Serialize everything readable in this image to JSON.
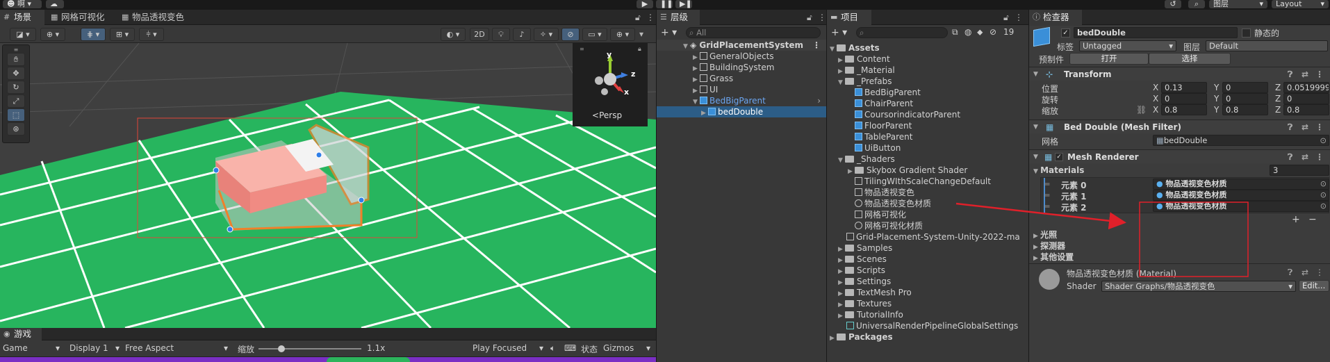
{
  "topbar": {
    "account_label": "啊",
    "layers_label": "图层",
    "layout_label": "Layout"
  },
  "scene_tabs": [
    {
      "label": "场景"
    },
    {
      "label": "网格可视化"
    },
    {
      "label": "物品透视变色"
    }
  ],
  "scene_toolbar": {
    "btn_2d": "2D"
  },
  "gizmo": {
    "y": "y",
    "z": "z",
    "x": "x",
    "persp": "Persp"
  },
  "game_bar": {
    "tab_label": "游戏",
    "game_select": "Game",
    "display_select": "Display 1",
    "aspect_select": "Free Aspect",
    "scale_label": "缩放",
    "scale_value": "1.1x",
    "play_focused": "Play Focused",
    "stats_label": "状态",
    "gizmos_label": "Gizmos",
    "scale_fraction": 0.22
  },
  "hierarchy": {
    "tab_label": "层级",
    "search_placeholder": "All",
    "scene_name": "GridPlacementSystem",
    "items": [
      {
        "label": "GeneralObjects"
      },
      {
        "label": "BuildingSystem"
      },
      {
        "label": "Grass"
      },
      {
        "label": "UI"
      },
      {
        "label": "BedBigParent"
      },
      {
        "label": "bedDouble"
      }
    ]
  },
  "project": {
    "tab_label": "项目",
    "badge_count": "19",
    "assets_label": "Assets",
    "items": [
      {
        "label": "Content"
      },
      {
        "label": "_Material"
      },
      {
        "label": "_Prefabs"
      },
      {
        "label": "BedBigParent"
      },
      {
        "label": "ChairParent"
      },
      {
        "label": "CoursorindicatorParent"
      },
      {
        "label": "FloorParent"
      },
      {
        "label": "TableParent"
      },
      {
        "label": "UiButton"
      },
      {
        "label": "_Shaders"
      },
      {
        "label": "Skybox Gradient Shader"
      },
      {
        "label": "TilingWIthScaleChangeDefault"
      },
      {
        "label": "物品透视变色"
      },
      {
        "label": "物品透视变色材质"
      },
      {
        "label": "网格可视化"
      },
      {
        "label": "网格可视化材质"
      },
      {
        "label": "Grid-Placement-System-Unity-2022-ma"
      },
      {
        "label": "Samples"
      },
      {
        "label": "Scenes"
      },
      {
        "label": "Scripts"
      },
      {
        "label": "Settings"
      },
      {
        "label": "TextMesh Pro"
      },
      {
        "label": "Textures"
      },
      {
        "label": "TutorialInfo"
      },
      {
        "label": "UniversalRenderPipelineGlobalSettings"
      }
    ],
    "packages_label": "Packages"
  },
  "inspector": {
    "tab_label": "检查器",
    "object_name": "bedDouble",
    "static_label": "静态的",
    "tag_label": "标签",
    "tag_value": "Untagged",
    "layer_label": "图层",
    "layer_value": "Default",
    "prefab_label": "预制件",
    "open_button": "打开",
    "select_button": "选择",
    "transform": {
      "title": "Transform",
      "position_label": "位置",
      "rotation_label": "旋转",
      "scale_label": "缩放",
      "axis_x": "X",
      "axis_y": "Y",
      "axis_z": "Z",
      "position": [
        "0.13",
        "0",
        "0.0519999"
      ],
      "rotation": [
        "0",
        "0",
        "0"
      ],
      "scale": [
        "0.8",
        "0.8",
        "0.8"
      ]
    },
    "mesh_filter": {
      "title": "Bed Double (Mesh Filter)",
      "mesh_label": "网格",
      "mesh_value": "bedDouble"
    },
    "mesh_renderer": {
      "title": "Mesh Renderer",
      "materials_label": "Materials",
      "materials_count": "3",
      "elements": [
        {
          "label": "元素 0",
          "value": "物品透视变色材质"
        },
        {
          "label": "元素 1",
          "value": "物品透视变色材质"
        },
        {
          "label": "元素 2",
          "value": "物品透视变色材质"
        }
      ],
      "plus": "+",
      "minus": "−",
      "lighting_label": "光照",
      "probes_label": "探测器",
      "other_label": "其他设置"
    },
    "material": {
      "title": "物品透视变色材质 (Material)",
      "shader_label": "Shader",
      "shader_value": "Shader Graphs/物品透视变色",
      "edit_button": "Edit..."
    }
  }
}
